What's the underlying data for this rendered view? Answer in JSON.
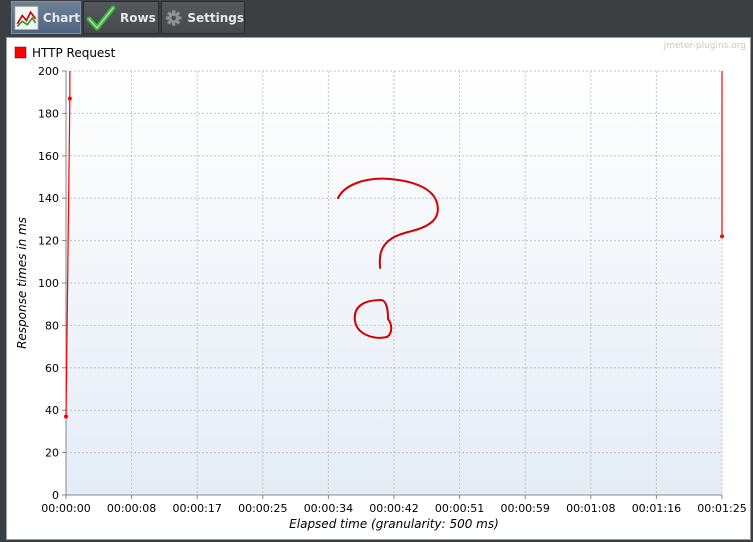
{
  "tabs": [
    {
      "label": "Chart",
      "icon": "line-chart-icon",
      "active": true
    },
    {
      "label": "Rows",
      "icon": "checkmark-icon",
      "active": false
    },
    {
      "label": "Settings",
      "icon": "gear-icon",
      "active": false
    }
  ],
  "watermark": "jmeter-plugins.org",
  "chart_data": {
    "type": "line",
    "xlabel": "Elapsed time (granularity: 500 ms)",
    "ylabel": "Response times in ms",
    "ylim": [
      0,
      200
    ],
    "yticks": [
      0,
      20,
      40,
      60,
      80,
      100,
      120,
      140,
      160,
      180,
      200
    ],
    "xticks": [
      "00:00:00",
      "00:00:08",
      "00:00:17",
      "00:00:25",
      "00:00:34",
      "00:00:42",
      "00:00:51",
      "00:00:59",
      "00:01:08",
      "00:01:16",
      "00:01:25"
    ],
    "xlim_seconds": [
      0,
      85
    ],
    "grid": true,
    "legend_position": "top-left",
    "series": [
      {
        "name": "HTTP Request",
        "color": "#ff0000",
        "segments": [
          [
            {
              "x": "00:00:00",
              "y": 37
            },
            {
              "x": "00:00:00.5",
              "y": 187
            },
            {
              "x": "00:00:00.5",
              "y": 200
            }
          ],
          [
            {
              "x": "00:01:25",
              "y": 200
            },
            {
              "x": "00:01:25",
              "y": 122
            }
          ]
        ]
      }
    ],
    "annotation": "hand-drawn red question mark"
  }
}
